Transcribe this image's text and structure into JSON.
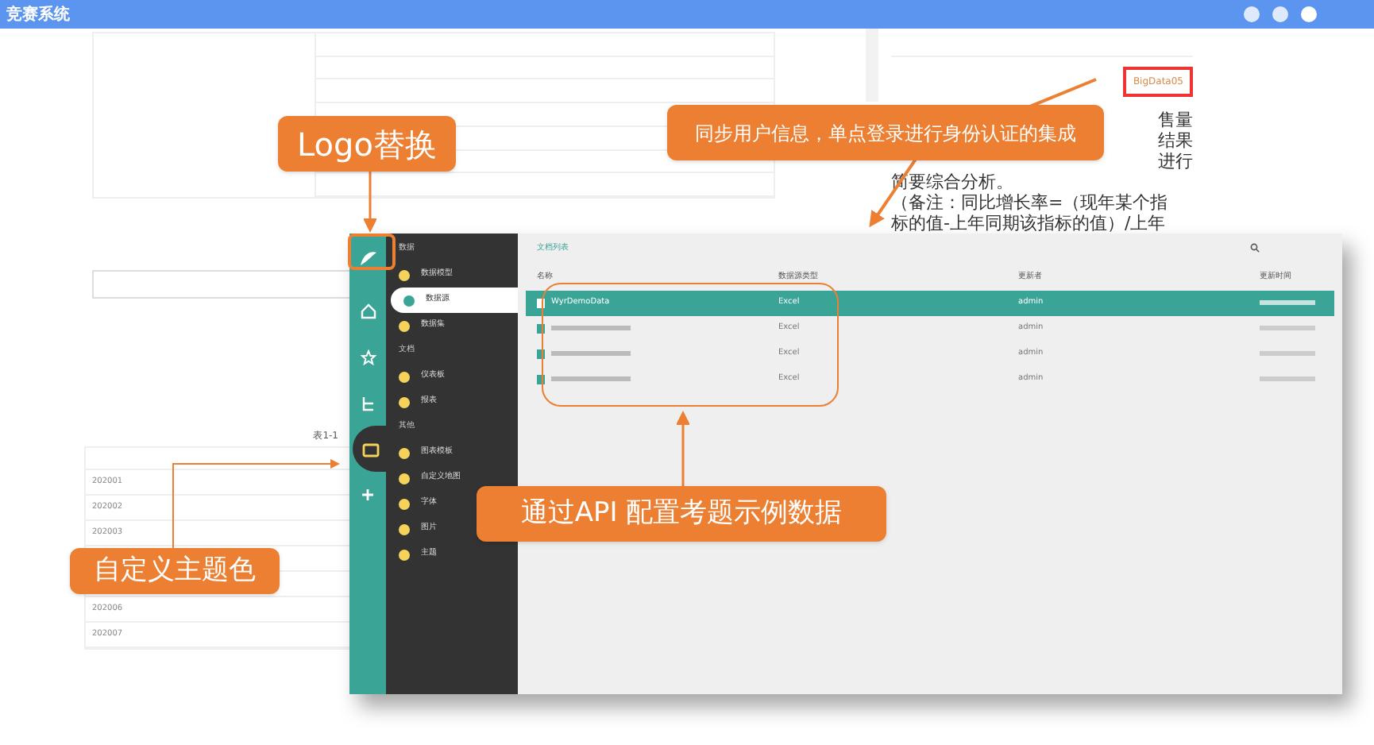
{
  "top_bar": {
    "title": "竞赛系统"
  },
  "document": {
    "table_rows": [
      "202001",
      "202002",
      "202003",
      "",
      "",
      "202006",
      "202007"
    ],
    "caption": "表1-1"
  },
  "question_panel": {
    "tag": "BigData05",
    "lines": [
      {
        "text": "售量",
        "kind": "fragment"
      },
      {
        "text": "结果",
        "kind": "fragment"
      },
      {
        "text": "进行",
        "kind": "fragment"
      },
      {
        "text": "简要综合分析。",
        "kind": "line"
      },
      {
        "text": "（备注：同比增长率=（现年某个指",
        "kind": "line"
      },
      {
        "text": "标的值-上年同期该指标的值）/上年",
        "kind": "line"
      }
    ]
  },
  "app_window": {
    "rail": [
      {
        "kind": "logo",
        "selected": false
      },
      {
        "kind": "home",
        "selected": false
      },
      {
        "kind": "star",
        "selected": false
      },
      {
        "kind": "tree",
        "selected": false
      },
      {
        "kind": "folder",
        "selected": true
      },
      {
        "kind": "plus",
        "selected": false
      }
    ],
    "menu": [
      {
        "kind": "header",
        "label": "数据"
      },
      {
        "kind": "item",
        "label": "数据模型",
        "selected": false
      },
      {
        "kind": "item",
        "label": "数据源",
        "selected": true
      },
      {
        "kind": "item",
        "label": "数据集",
        "selected": false
      },
      {
        "kind": "header",
        "label": "文档"
      },
      {
        "kind": "item",
        "label": "仪表板",
        "selected": false
      },
      {
        "kind": "item",
        "label": "报表",
        "selected": false
      },
      {
        "kind": "header",
        "label": "其他"
      },
      {
        "kind": "item",
        "label": "图表模板",
        "selected": false
      },
      {
        "kind": "item",
        "label": "自定义地图",
        "selected": false
      },
      {
        "kind": "item",
        "label": "字体",
        "selected": false
      },
      {
        "kind": "item",
        "label": "图片",
        "selected": false
      },
      {
        "kind": "item",
        "label": "主题",
        "selected": false
      }
    ],
    "list_title": "文档列表",
    "columns": [
      "名称",
      "数据源类型",
      "更新者",
      "更新时间"
    ],
    "rows": [
      {
        "name": "WyrDemoData",
        "type": "Excel",
        "updater": "admin",
        "selected": true
      },
      {
        "name": "",
        "type": "Excel",
        "updater": "admin",
        "selected": false
      },
      {
        "name": "",
        "type": "Excel",
        "updater": "admin",
        "selected": false
      },
      {
        "name": "",
        "type": "Excel",
        "updater": "admin",
        "selected": false
      }
    ]
  },
  "callouts": [
    {
      "kind": "logo",
      "text": "Logo替换"
    },
    {
      "kind": "sso",
      "text": "同步用户信息，单点登录进行身份认证的集成"
    },
    {
      "kind": "api",
      "text": "通过API 配置考题示例数据"
    },
    {
      "kind": "theme",
      "text": "自定义主题色"
    }
  ]
}
